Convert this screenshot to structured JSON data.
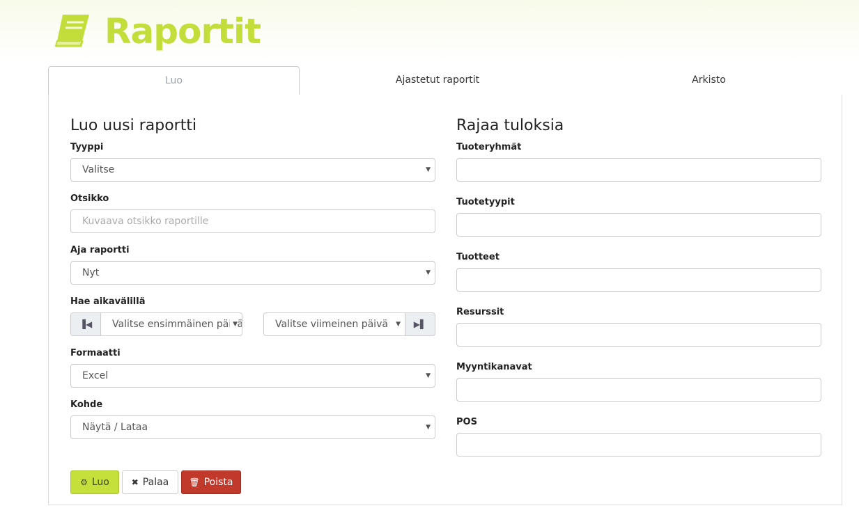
{
  "header": {
    "title": "Raportit",
    "icon": "book-icon",
    "accent": "#c3dd3a"
  },
  "tabs": [
    {
      "label": "Luo",
      "active": true
    },
    {
      "label": "Ajastetut raportit",
      "active": false
    },
    {
      "label": "Arkisto",
      "active": false
    }
  ],
  "create": {
    "heading": "Luo uusi raportti",
    "type": {
      "label": "Tyyppi",
      "value": "Valitse"
    },
    "title": {
      "label": "Otsikko",
      "placeholder": "Kuvaava otsikko raportille"
    },
    "run": {
      "label": "Aja raportti",
      "value": "Nyt"
    },
    "range": {
      "label": "Hae aikavälillä",
      "start": "Valitse ensimmäinen päivä",
      "end": "Valitse viimeinen päivä"
    },
    "format": {
      "label": "Formaatti",
      "value": "Excel"
    },
    "target": {
      "label": "Kohde",
      "value": "Näytä / Lataa"
    }
  },
  "filters": {
    "heading": "Rajaa tuloksia",
    "fields": [
      {
        "label": "Tuoteryhmät"
      },
      {
        "label": "Tuotetyypit"
      },
      {
        "label": "Tuotteet"
      },
      {
        "label": "Resurssit"
      },
      {
        "label": "Myyntikanavat"
      },
      {
        "label": "POS"
      }
    ]
  },
  "buttons": {
    "create": "Luo",
    "back": "Palaa",
    "delete": "Poista"
  },
  "colors": {
    "create_btn": "#c5e03b",
    "delete_btn": "#c0392b"
  }
}
